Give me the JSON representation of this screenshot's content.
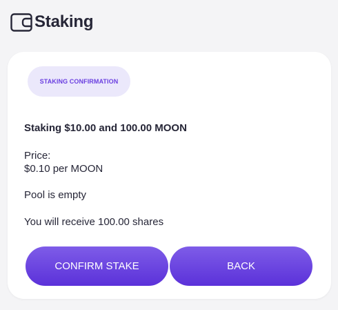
{
  "app": {
    "title": "Staking",
    "icon": "wallet-icon"
  },
  "card": {
    "badge": "STAKING CONFIRMATION",
    "summary": "Staking $10.00 and 100.00 MOON",
    "price_label": "Price:",
    "price_value": "$0.10 per MOON",
    "pool_status": "Pool is empty",
    "shares_info": "You will receive 100.00 shares"
  },
  "buttons": {
    "confirm_label": "CONFIRM STAKE",
    "back_label": "BACK"
  },
  "colors": {
    "accent": "#6a3fe0",
    "badge_bg": "#ebe8fb",
    "text": "#262637",
    "background": "#f4f4f6"
  }
}
